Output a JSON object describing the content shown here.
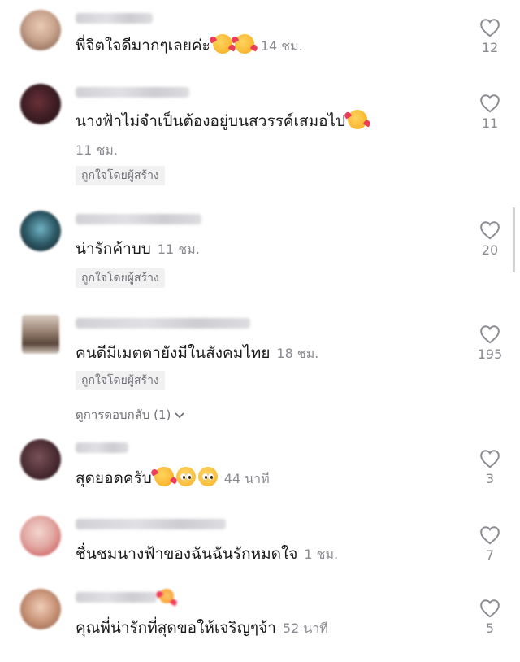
{
  "comments": [
    {
      "text": "พี่จิตใจดีมากๆเลยค่ะ",
      "emojis": [
        "smiling-face-with-hearts",
        "smiling-face-with-hearts"
      ],
      "time": "14 ชม.",
      "likes": "12",
      "badge": "",
      "replies": ""
    },
    {
      "text": "นางฟ้าไม่จำเป็นต้องอยู่บนสวรรค์เสมอไป",
      "emojis": [
        "smiling-face-with-hearts"
      ],
      "time": "11 ชม.",
      "likes": "11",
      "badge": "ถูกใจโดยผู้สร้าง",
      "replies": ""
    },
    {
      "text": "น่ารักค้าบบ",
      "emojis": [],
      "time": "11 ชม.",
      "likes": "20",
      "badge": "ถูกใจโดยผู้สร้าง",
      "replies": ""
    },
    {
      "text": "คนดีมีเมตตายังมีในสังคมไทย",
      "emojis": [],
      "time": "18 ชม.",
      "likes": "195",
      "badge": "ถูกใจโดยผู้สร้าง",
      "replies": "ดูการตอบกลับ (1)"
    },
    {
      "text": "สุดยอดครับ",
      "emojis": [
        "smiling-face-with-hearts",
        "pleading-face",
        "pleading-face"
      ],
      "time": "44 นาที",
      "likes": "3",
      "badge": "",
      "replies": ""
    },
    {
      "text": "ชื่นชมนางฟ้าของฉันฉันรักหมดใจ",
      "emojis": [],
      "time": "1 ชม.",
      "likes": "7",
      "badge": "",
      "replies": ""
    },
    {
      "text": "คุณพี่น่ารักที่สุดขอให้เจริญๆจ้า",
      "emojis": [],
      "time": "52 นาที",
      "likes": "5",
      "badge": "",
      "replies": ""
    }
  ],
  "icons": {
    "like": "heart-outline-icon",
    "expand": "chevron-down-icon"
  },
  "colors": {
    "text": "#161823",
    "muted": "#8a8b91",
    "badge_bg": "#f1f1f2"
  }
}
